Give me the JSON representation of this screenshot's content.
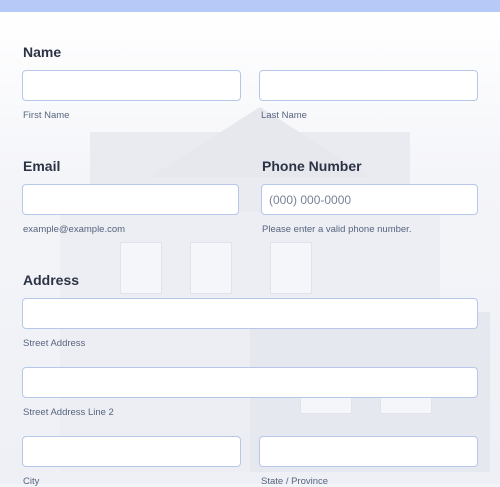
{
  "form": {
    "name": {
      "label": "Name",
      "first_sublabel": "First Name",
      "last_sublabel": "Last Name",
      "first_value": "",
      "last_value": ""
    },
    "email": {
      "label": "Email",
      "sublabel": "example@example.com",
      "value": ""
    },
    "phone": {
      "label": "Phone Number",
      "placeholder": "(000) 000-0000",
      "sublabel": "Please enter a valid phone number.",
      "value": ""
    },
    "address": {
      "label": "Address",
      "street_sublabel": "Street Address",
      "street2_sublabel": "Street Address Line 2",
      "city_sublabel": "City",
      "state_sublabel": "State / Province",
      "street_value": "",
      "street2_value": "",
      "city_value": "",
      "state_value": ""
    }
  },
  "colors": {
    "accent_bar": "#b7c9f7",
    "field_border": "#b8c6ea",
    "label_text": "#2c3345"
  }
}
